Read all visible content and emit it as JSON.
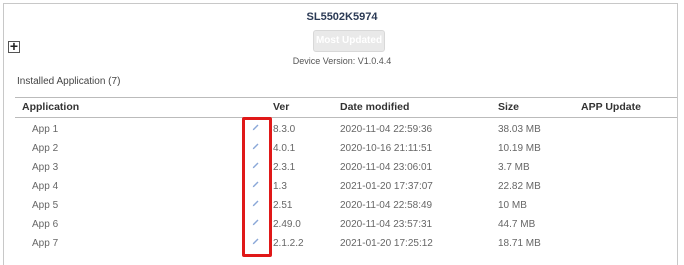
{
  "device": {
    "title": "SL5502K5974",
    "most_updated_label": "Most Updated",
    "version": "Device Version: V1.0.4.4",
    "add_label": "+"
  },
  "installed": {
    "label": "Installed Application (7)"
  },
  "table": {
    "headers": [
      "Application",
      "Ver",
      "Date modified",
      "Size",
      "APP Update"
    ],
    "rows": [
      {
        "app": "App 1",
        "ver": "8.3.0",
        "date": "2020-11-04 22:59:36",
        "size": "38.03 MB"
      },
      {
        "app": "App 2",
        "ver": "4.0.1",
        "date": "2020-10-16 21:11:51",
        "size": "10.19 MB"
      },
      {
        "app": "App 3",
        "ver": "2.3.1",
        "date": "2020-11-04 23:06:01",
        "size": "3.7 MB"
      },
      {
        "app": "App 4",
        "ver": "1.3",
        "date": "2021-01-20 17:37:07",
        "size": "22.82 MB"
      },
      {
        "app": "App 5",
        "ver": "2.51",
        "date": "2020-11-04 22:58:49",
        "size": "10 MB"
      },
      {
        "app": "App 6",
        "ver": "2.49.0",
        "date": "2020-11-04 23:57:31",
        "size": "44.7 MB"
      },
      {
        "app": "App 7",
        "ver": "2.1.2.2",
        "date": "2021-01-20 17:25:12",
        "size": "18.71 MB"
      }
    ]
  },
  "colors": {
    "highlight": "#e01818",
    "edit_icon": "#8aa7d8",
    "title": "#2b3a55"
  },
  "icons": {
    "row_edit": "pencil-icon",
    "add": "plus-icon"
  }
}
